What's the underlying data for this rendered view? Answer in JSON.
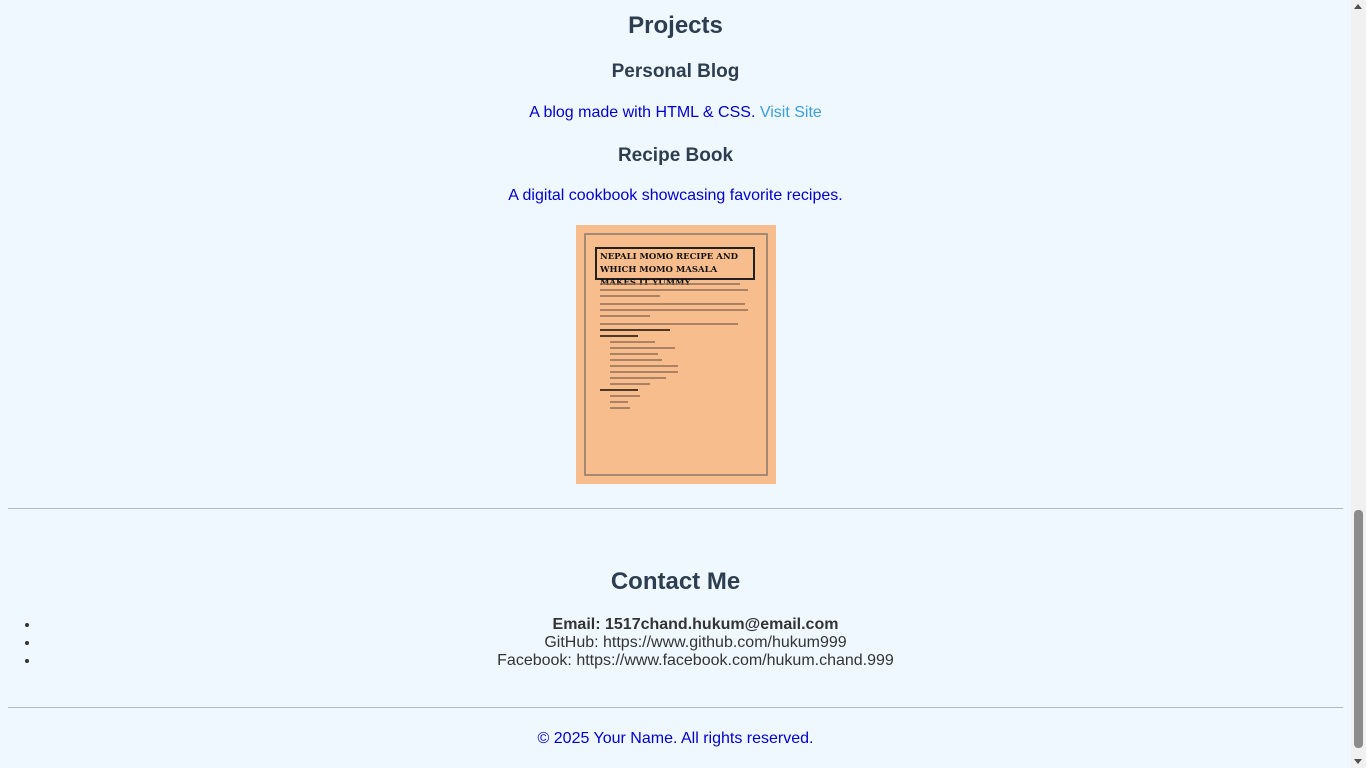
{
  "projects": {
    "title": "Projects",
    "items": [
      {
        "title": "Personal Blog",
        "description": "A blog made with HTML & CSS. ",
        "link_text": "Visit Site"
      },
      {
        "title": "Recipe Book",
        "description": "A digital cookbook showcasing favorite recipes.",
        "image_title": "NEPALI MOMO RECIPE AND WHICH MOMO MASALA MAKES IT YUMMY"
      }
    ]
  },
  "contact": {
    "title": "Contact Me",
    "items": [
      "Email: 1517chand.hukum@email.com",
      "GitHub: https://www.github.com/hukum999",
      "Facebook: https://www.facebook.com/hukum.chand.999"
    ]
  },
  "footer": {
    "text": "© 2025 Your Name. All rights reserved."
  },
  "colors": {
    "background": "#f0f8ff",
    "heading": "#2c3e50",
    "description": "#0000cd",
    "link": "#3a9fd6"
  }
}
